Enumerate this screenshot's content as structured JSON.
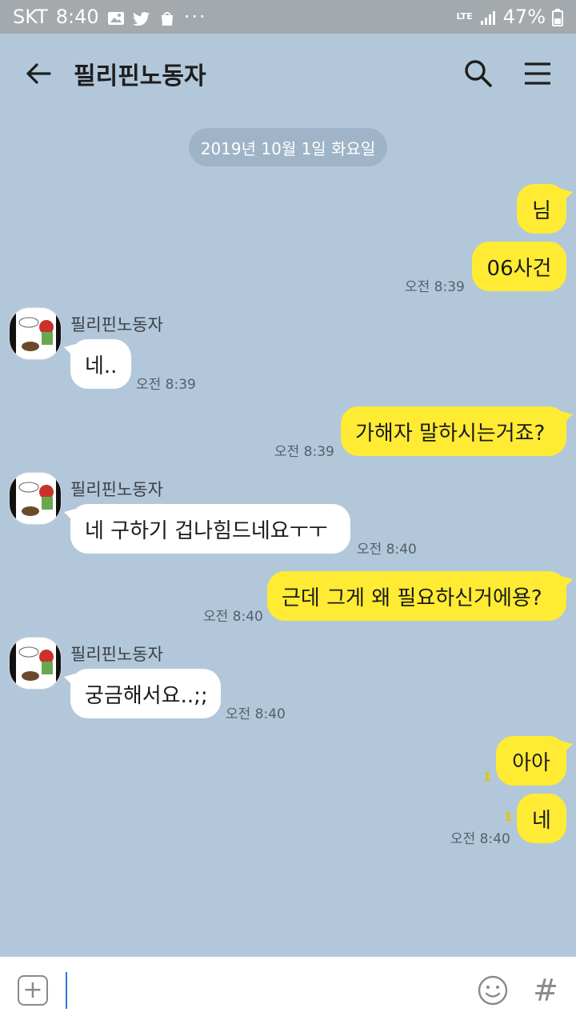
{
  "status": {
    "carrier": "SKT",
    "time": "8:40",
    "network": "LTE",
    "battery": "47%"
  },
  "header": {
    "title": "필리핀노동자"
  },
  "chat": {
    "date": "2019년 10월 1일 화요일",
    "messages": [
      {
        "side": "me",
        "text": "님"
      },
      {
        "side": "me",
        "text": "06사건",
        "time": "오전 8:39"
      },
      {
        "side": "them",
        "sender": "필리핀노동자",
        "text": "네..",
        "time": "오전 8:39"
      },
      {
        "side": "me",
        "text": "가해자 말하시는거죠?",
        "time": "오전 8:39"
      },
      {
        "side": "them",
        "sender": "필리핀노동자",
        "text": "네 구하기 겁나힘드네요ㅜㅜ",
        "time": "오전 8:40"
      },
      {
        "side": "me",
        "text": "근데 그게 왜 필요하신거에용?",
        "time": "오전 8:40"
      },
      {
        "side": "them",
        "sender": "필리핀노동자",
        "text": "궁금해서요..;;",
        "time": "오전 8:40"
      },
      {
        "side": "me",
        "text": "아아",
        "unread": "1"
      },
      {
        "side": "me",
        "text": "네",
        "unread": "1",
        "time": "오전 8:40"
      }
    ]
  },
  "input": {
    "value": ""
  },
  "colors": {
    "background": "#b2c7da",
    "my_bubble": "#ffeb33",
    "their_bubble": "#ffffff"
  }
}
